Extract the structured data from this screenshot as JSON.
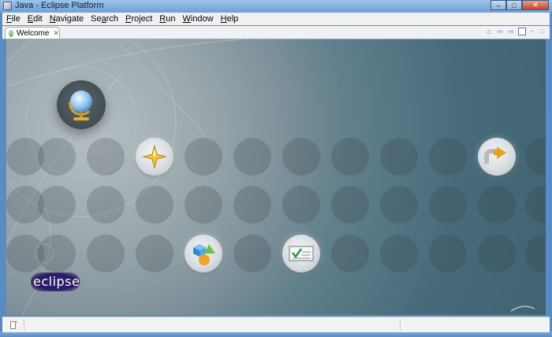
{
  "window": {
    "title": "Java - Eclipse Platform",
    "minimize": "–",
    "maximize": "□",
    "close": "✕"
  },
  "menu": [
    {
      "accel": "F",
      "rest": "ile"
    },
    {
      "accel": "E",
      "rest": "dit"
    },
    {
      "accel": "N",
      "rest": "avigate"
    },
    {
      "accel": "",
      "pre": "Se",
      "accel2": "a",
      "rest": "rch"
    },
    {
      "accel": "P",
      "rest": "roject"
    },
    {
      "accel": "R",
      "rest": "un"
    },
    {
      "accel": "W",
      "rest": "indow"
    },
    {
      "accel": "H",
      "rest": "elp"
    }
  ],
  "tab": {
    "label": "Welcome",
    "close": "✕"
  },
  "welcome": {
    "logo_text": "eclipse",
    "icons": [
      "overview-icon",
      "tutorials-icon",
      "samples-icon",
      "whats-new-icon",
      "workbench-icon"
    ]
  },
  "view_tools": {
    "home": "⌂",
    "back": "⇦",
    "forward": "⇨",
    "minimize": "–",
    "maximize": "□"
  },
  "colors": {
    "accent": "#5a8cc4",
    "welcome_bg": "#476b7a",
    "logo": "#2a1d63"
  }
}
